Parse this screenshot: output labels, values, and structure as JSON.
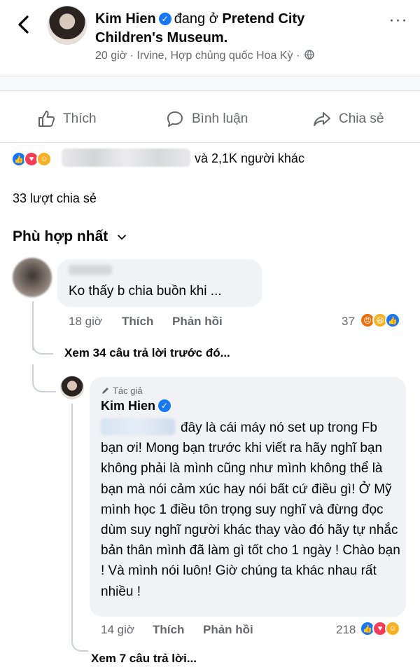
{
  "header": {
    "author_name": "Kim Hien",
    "status_prefix": "đang ở",
    "place_line1": "Pretend City",
    "place_line2": "Children's Museum.",
    "time": "20 giờ",
    "separator": "·",
    "location": "Irvine, Hợp chủng quốc Hoa Kỳ",
    "separator2": "·"
  },
  "actions": {
    "like_label": "Thích",
    "comment_label": "Bình luận",
    "share_label": "Chia sẻ"
  },
  "reactions_summary": {
    "others_text": "và 2,1K người khác",
    "icons": [
      "like-reaction",
      "love-reaction",
      "care-reaction"
    ]
  },
  "shares_text": "33 lượt chia sẻ",
  "sort_label": "Phù hợp nhất",
  "comments": [
    {
      "text": "Ko thấy b chia buồn khi ...",
      "time": "18 giờ",
      "like_label": "Thích",
      "reply_label": "Phản hồi",
      "reaction_count": "37",
      "reaction_icons": [
        "angry-reaction",
        "haha-reaction",
        "like-reaction"
      ],
      "view_more_label": "Xem 34 câu trả lời trước đó..."
    },
    {
      "author_badge": "Tác giả",
      "author_name": "Kim Hien",
      "line1": "đây là cái máy nó set up trong Fb",
      "rest": "bạn ơi! Mong bạn trước khi viết ra hãy nghĩ bạn không phải là mình cũng như mình không thể là bạn mà nói cảm xúc hay nói bất cứ điều gì! Ở Mỹ mình học 1 điều tôn trọng suy nghĩ và đừng đọc dùm suy nghĩ người khác thay vào đó hãy tự nhắc bản thân mình đã làm gì tốt cho 1 ngày ! Chào bạn ! Và mình nói luôn! Giờ chúng ta khác nhau rất nhiều !",
      "time": "14 giờ",
      "like_label": "Thích",
      "reply_label": "Phản hồi",
      "reaction_count": "218",
      "reaction_icons": [
        "like-reaction",
        "love-reaction",
        "care-reaction"
      ],
      "view_more_label": "Xem 7 câu trả lời..."
    }
  ],
  "colors": {
    "facebook_blue": "#1877f2",
    "secondary_text": "#65676b",
    "bubble_bg": "#f0f2f5"
  }
}
